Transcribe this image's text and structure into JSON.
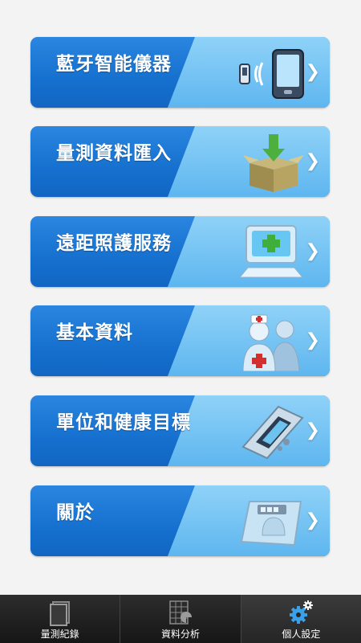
{
  "menu": [
    {
      "label": "藍牙智能儀器",
      "icon": "bluetooth-device-icon",
      "chevron": "❯"
    },
    {
      "label": "量測資料匯入",
      "icon": "import-box-icon",
      "chevron": "❯"
    },
    {
      "label": "遠距照護服務",
      "icon": "telecare-monitor-icon",
      "chevron": "❯"
    },
    {
      "label": "基本資料",
      "icon": "doctor-nurse-icon",
      "chevron": "❯"
    },
    {
      "label": "單位和健康目標",
      "icon": "meter-device-icon",
      "chevron": "❯"
    },
    {
      "label": "關於",
      "icon": "scale-device-icon",
      "chevron": "❯"
    }
  ],
  "tabs": [
    {
      "label": "量測紀錄",
      "icon": "notebook-icon",
      "active": false
    },
    {
      "label": "資料分析",
      "icon": "chart-icon",
      "active": false
    },
    {
      "label": "個人設定",
      "icon": "gears-icon",
      "active": true
    }
  ],
  "colors": {
    "card_blue": "#1670cf",
    "card_sheen": "#7cc8f5",
    "tab_bg": "#1a1a1a",
    "gear_blue": "#3aa0e8"
  }
}
